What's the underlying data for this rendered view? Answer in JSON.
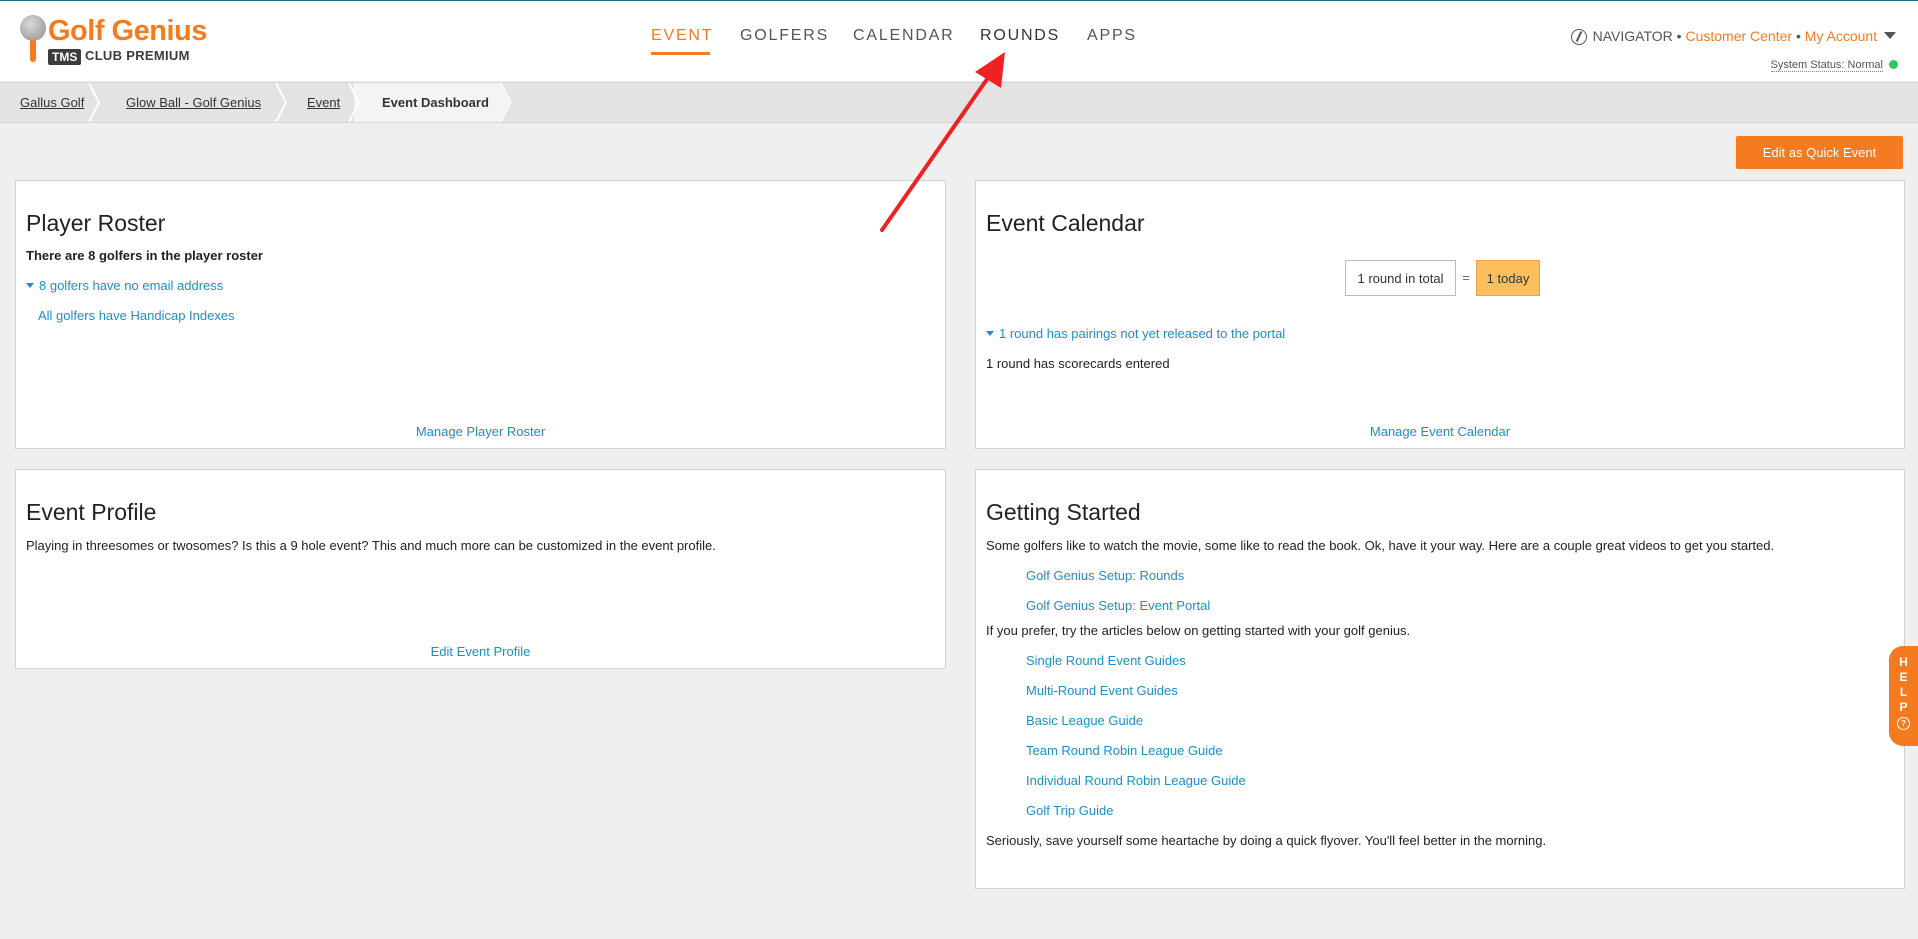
{
  "brand": {
    "name": "Golf Genius",
    "tms": "TMS",
    "tier": "CLUB PREMIUM",
    "accent_color": "#f47b20"
  },
  "nav": {
    "items": [
      {
        "label": "EVENT",
        "active": true
      },
      {
        "label": "GOLFERS",
        "active": false
      },
      {
        "label": "CALENDAR",
        "active": false
      },
      {
        "label": "ROUNDS",
        "active": false
      },
      {
        "label": "APPS",
        "active": false
      }
    ]
  },
  "account": {
    "navigator": "NAVIGATOR",
    "bullet": "•",
    "customer_center": "Customer Center",
    "my_account": "My Account",
    "system_status_label": "System Status: Normal",
    "status_color": "#2ec95c"
  },
  "breadcrumb": {
    "items": [
      {
        "label": "Gallus Golf"
      },
      {
        "label": "Glow Ball - Golf Genius"
      },
      {
        "label": "Event"
      },
      {
        "label": "Event Dashboard"
      }
    ]
  },
  "quick_event_button": "Edit as Quick Event",
  "player_roster": {
    "title": "Player Roster",
    "summary": "There are 8 golfers in the player roster",
    "no_email": "8 golfers have no email address",
    "handicap": "All golfers have Handicap Indexes",
    "manage_link": "Manage Player Roster"
  },
  "event_calendar": {
    "title": "Event Calendar",
    "rounds_total": "1 round in total",
    "equals": "=",
    "rounds_today": "1 today",
    "pairings_note": "1 round has pairings not yet released to the portal",
    "scorecards_note": "1 round has scorecards entered",
    "manage_link": "Manage Event Calendar"
  },
  "event_profile": {
    "title": "Event Profile",
    "description": "Playing in threesomes or twosomes? Is this a 9 hole event? This and much more can be customized in the event profile.",
    "edit_link": "Edit Event Profile"
  },
  "getting_started": {
    "title": "Getting Started",
    "intro": "Some golfers like to watch the movie, some like to read the book. Ok, have it your way. Here are a couple great videos to get you started.",
    "videos": [
      "Golf Genius Setup: Rounds",
      "Golf Genius Setup: Event Portal"
    ],
    "articles_intro": "If you prefer, try the articles below on getting started with your golf genius.",
    "articles": [
      "Single Round Event Guides",
      "Multi-Round Event Guides",
      "Basic League Guide",
      "Team Round Robin League Guide",
      "Individual Round Robin League Guide",
      "Golf Trip Guide"
    ],
    "outro": "Seriously, save yourself some heartache by doing a quick flyover. You'll feel better in the morning."
  },
  "help_tab": {
    "letters": [
      "H",
      "E",
      "L",
      "P"
    ],
    "icon": "question-circle-icon"
  },
  "annotation": {
    "type": "red-arrow",
    "color": "#ee2222",
    "points_to": "ROUNDS"
  }
}
